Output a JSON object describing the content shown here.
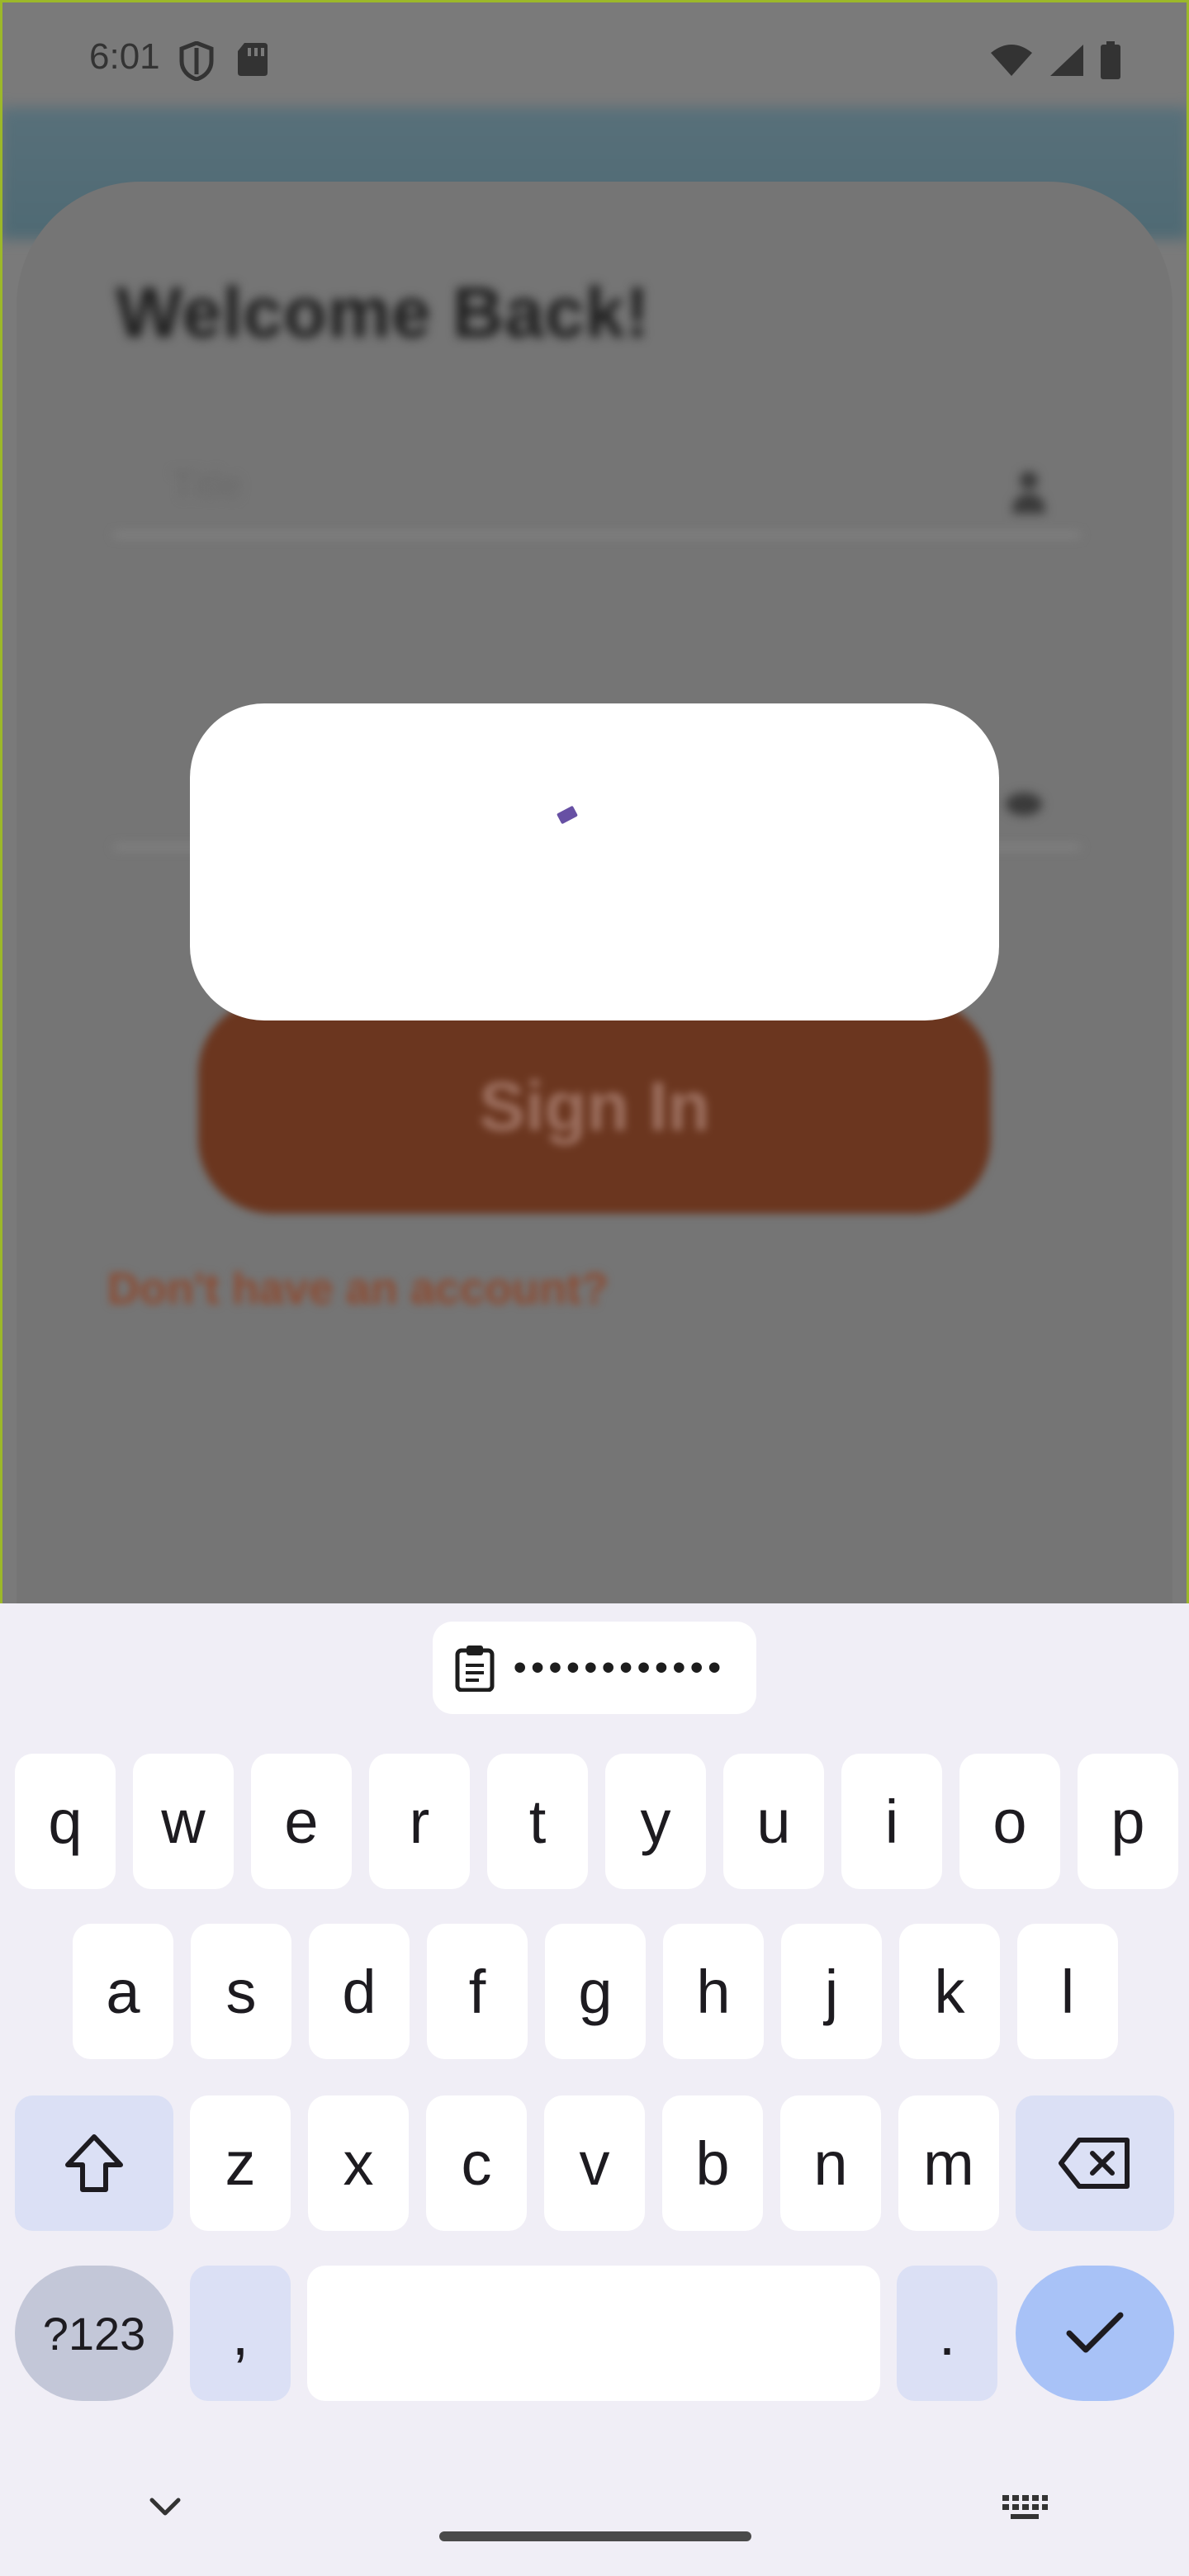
{
  "status_bar": {
    "time": "6:01",
    "left_icons": [
      "shield-icon",
      "sd-card-icon"
    ],
    "right_icons": [
      "wifi-icon",
      "signal-icon",
      "battery-icon"
    ]
  },
  "login": {
    "title": "Welcome Back!",
    "username_placeholder": "Title",
    "sign_in_label": "Sign In",
    "register_link": "Don't have an account?"
  },
  "dialog": {
    "state": "loading",
    "accent_color": "#6750a4"
  },
  "keyboard": {
    "clipboard_suggestion": "••••••••••••",
    "row1": [
      "q",
      "w",
      "e",
      "r",
      "t",
      "y",
      "u",
      "i",
      "o",
      "p"
    ],
    "row2": [
      "a",
      "s",
      "d",
      "f",
      "g",
      "h",
      "j",
      "k",
      "l"
    ],
    "row3": [
      "z",
      "x",
      "c",
      "v",
      "b",
      "n",
      "m"
    ],
    "symbols_label": "?123",
    "comma_label": ",",
    "period_label": ".",
    "icons": {
      "shift": "shift-icon",
      "backspace": "backspace-icon",
      "enter": "checkmark-icon",
      "clipboard": "clipboard-icon",
      "hide": "chevron-down-icon",
      "switch": "keyboard-icon"
    }
  }
}
